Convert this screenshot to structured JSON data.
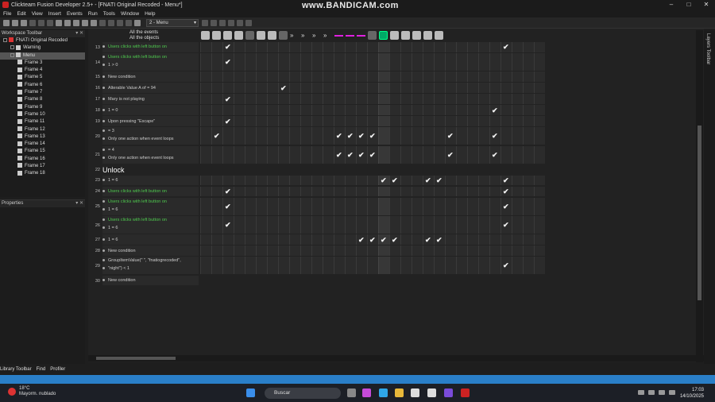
{
  "window": {
    "title": "Clickteam Fusion Developer 2.5+ - [FNATI Original Recoded - Menu*]",
    "watermark": "www.BANDICAM.com",
    "controls": [
      "–",
      "□",
      "✕"
    ]
  },
  "menu": [
    "File",
    "Edit",
    "View",
    "Insert",
    "Events",
    "Run",
    "Tools",
    "Window",
    "Help"
  ],
  "toolbar": {
    "frame_select": "2 - Menu"
  },
  "workspace": {
    "title": "Workspace Toolbar",
    "items": [
      {
        "label": "FNATI Original Recoded",
        "level": 0,
        "icon": "app-icon",
        "selected": false
      },
      {
        "label": "Warning",
        "level": 1,
        "icon": "frame-icon",
        "selected": false
      },
      {
        "label": "Menu",
        "level": 1,
        "icon": "frame-icon",
        "selected": true
      },
      {
        "label": "Frame 3",
        "level": 2,
        "icon": "frame-icon",
        "selected": false
      },
      {
        "label": "Frame 4",
        "level": 2,
        "icon": "frame-icon",
        "selected": false
      },
      {
        "label": "Frame 5",
        "level": 2,
        "icon": "frame-icon",
        "selected": false
      },
      {
        "label": "Frame 6",
        "level": 2,
        "icon": "frame-icon",
        "selected": false
      },
      {
        "label": "Frame 7",
        "level": 2,
        "icon": "frame-icon",
        "selected": false
      },
      {
        "label": "Frame 8",
        "level": 2,
        "icon": "frame-icon",
        "selected": false
      },
      {
        "label": "Frame 9",
        "level": 2,
        "icon": "frame-icon",
        "selected": false
      },
      {
        "label": "Frame 10",
        "level": 2,
        "icon": "frame-icon",
        "selected": false
      },
      {
        "label": "Frame 11",
        "level": 2,
        "icon": "frame-icon",
        "selected": false
      },
      {
        "label": "Frame 12",
        "level": 2,
        "icon": "frame-icon",
        "selected": false
      },
      {
        "label": "Frame 13",
        "level": 2,
        "icon": "frame-icon",
        "selected": false
      },
      {
        "label": "Frame 14",
        "level": 2,
        "icon": "frame-icon",
        "selected": false
      },
      {
        "label": "Frame 15",
        "level": 2,
        "icon": "frame-icon",
        "selected": false
      },
      {
        "label": "Frame 16",
        "level": 2,
        "icon": "frame-icon",
        "selected": false
      },
      {
        "label": "Frame 17",
        "level": 2,
        "icon": "frame-icon",
        "selected": false
      },
      {
        "label": "Frame 18",
        "level": 2,
        "icon": "frame-icon",
        "selected": false
      }
    ]
  },
  "properties": {
    "title": "Properties"
  },
  "bottom_tabs": [
    "Library Toolbar",
    "Find",
    "Profiler"
  ],
  "layers_toolbar": "Layers Toolbar",
  "editor": {
    "header_label_1": "All the events",
    "header_label_2": "All the objects",
    "object_column_count": 31,
    "highlight_columns": [
      16
    ],
    "rows": [
      {
        "num": "13",
        "cond": [
          "Users clicks with left button on"
        ],
        "green": true,
        "checks": [
          2,
          27
        ]
      },
      {
        "num": "14",
        "cond": [
          "Users clicks with left button on",
          "1 > 0"
        ],
        "green": true,
        "checks": [
          2
        ]
      },
      {
        "num": "15",
        "cond": [
          "New condition"
        ],
        "green": false,
        "checks": []
      },
      {
        "num": "16",
        "cond": [
          "Alterable Value A of = 94"
        ],
        "green": false,
        "checks": [
          7
        ]
      },
      {
        "num": "17",
        "cond": [
          "Mary is not playing"
        ],
        "green": false,
        "checks": [
          2
        ]
      },
      {
        "num": "18",
        "cond": [
          "1 = 0"
        ],
        "green": false,
        "checks": [
          26
        ]
      },
      {
        "num": "19",
        "cond": [
          "Upon pressing \"Escape\""
        ],
        "green": false,
        "checks": [
          2
        ]
      },
      {
        "num": "20",
        "cond": [
          "= 3",
          "Only one action when event loops"
        ],
        "green": false,
        "checks": [
          1,
          12,
          13,
          14,
          15,
          22,
          26
        ]
      },
      {
        "num": "21",
        "cond": [
          "= 4",
          "Only one action when event loops"
        ],
        "green": false,
        "checks": [
          12,
          13,
          14,
          15,
          22,
          26
        ]
      },
      {
        "num": "22",
        "group": "Unlock"
      },
      {
        "num": "23",
        "cond": [
          "1 = 6"
        ],
        "green": false,
        "checks": [
          16,
          17,
          20,
          21,
          27
        ]
      },
      {
        "num": "24",
        "cond": [
          "Users clicks with left button on"
        ],
        "green": true,
        "checks": [
          2,
          27
        ]
      },
      {
        "num": "25",
        "cond": [
          "Users clicks with left button on",
          "1 = 6"
        ],
        "green": true,
        "checks": [
          2,
          27
        ]
      },
      {
        "num": "26",
        "cond": [
          "Users clicks with left button on",
          "1 = 6"
        ],
        "green": true,
        "checks": [
          2,
          27
        ]
      },
      {
        "num": "27",
        "cond": [
          "1 = 6"
        ],
        "green": false,
        "checks": [
          14,
          15,
          16,
          17,
          20,
          21
        ]
      },
      {
        "num": "28",
        "cond": [
          "New condition"
        ],
        "green": false,
        "checks": []
      },
      {
        "num": "29",
        "cond": [
          "GroupItemValue(\" \", \"fnatiogrecoded\",",
          "\"night\") < 1"
        ],
        "green": false,
        "checks": [
          27
        ]
      },
      {
        "num": "30",
        "cond": [
          "New condition"
        ],
        "green": false,
        "checks": [],
        "nogrid": true
      }
    ]
  },
  "taskbar": {
    "weather_temp": "18°C",
    "weather_desc": "Mayorm. nublado",
    "search": "Buscar",
    "time": "17:03",
    "date": "14/10/2025"
  }
}
